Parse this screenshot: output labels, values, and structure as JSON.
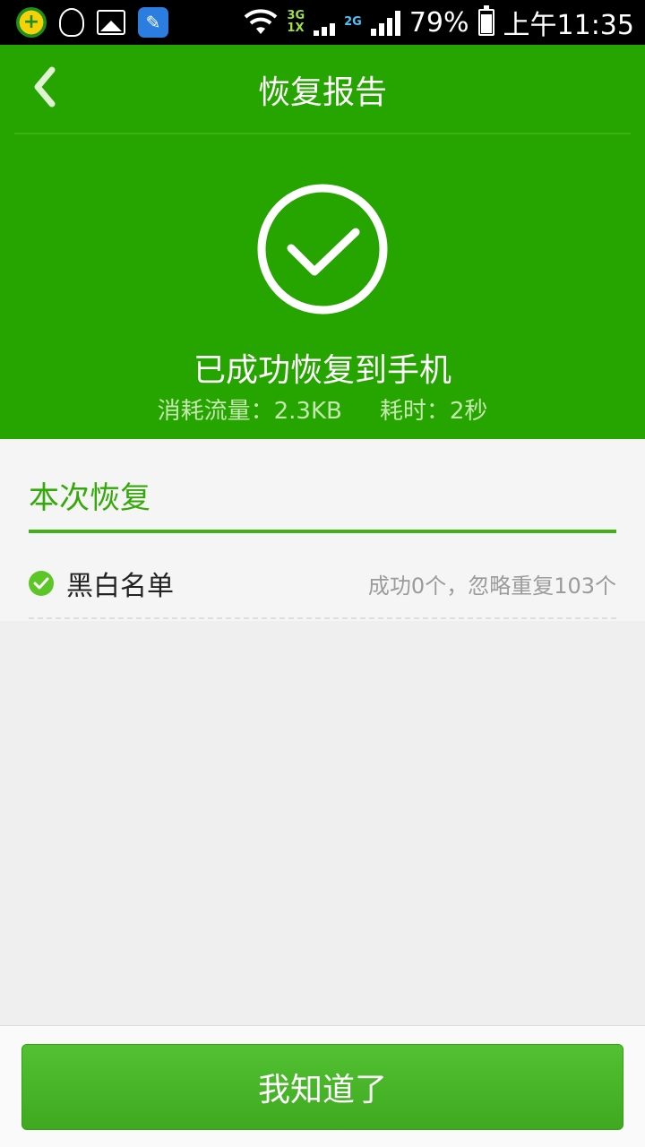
{
  "status_bar": {
    "network_3g": "3G",
    "network_1x": "1X",
    "network_2g": "2G",
    "battery": "79%",
    "time": "上午11:35"
  },
  "header": {
    "title": "恢复报告",
    "result_text": "已成功恢复到手机",
    "traffic": "消耗流量：2.3KB",
    "duration": "耗时：2秒"
  },
  "section": {
    "title": "本次恢复",
    "items": [
      {
        "label": "黑白名单",
        "status": "成功0个，忽略重复103个"
      }
    ]
  },
  "footer": {
    "button_label": "我知道了"
  },
  "colors": {
    "primary": "#26a400",
    "accent_text": "#35a80a",
    "button": "#4cb82c"
  }
}
